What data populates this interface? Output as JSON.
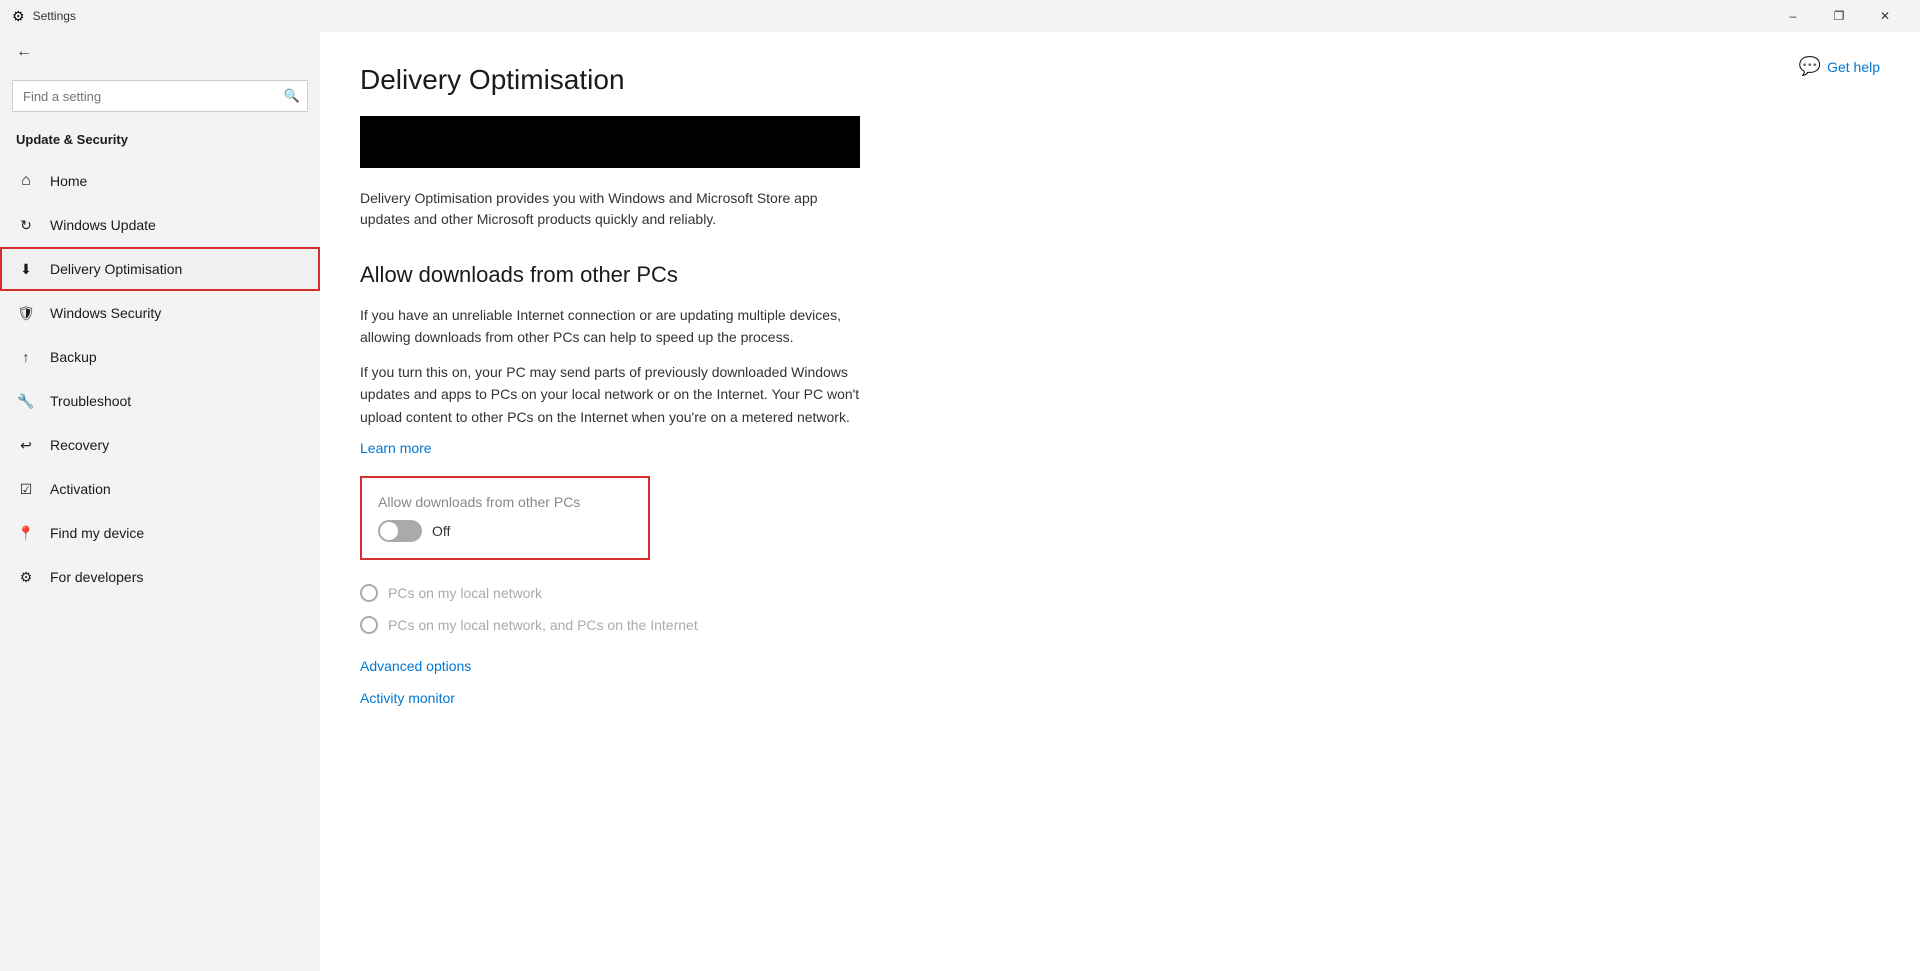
{
  "titlebar": {
    "title": "Settings",
    "minimize_label": "–",
    "maximize_label": "❐",
    "close_label": "✕"
  },
  "sidebar": {
    "back_label": "←",
    "search_placeholder": "Find a setting",
    "section_title": "Update & Security",
    "items": [
      {
        "id": "home",
        "label": "Home",
        "icon": "⌂"
      },
      {
        "id": "windows-update",
        "label": "Windows Update",
        "icon": "↻"
      },
      {
        "id": "delivery-optimisation",
        "label": "Delivery Optimisation",
        "icon": "⬇"
      },
      {
        "id": "windows-security",
        "label": "Windows Security",
        "icon": "🛡"
      },
      {
        "id": "backup",
        "label": "Backup",
        "icon": "↑"
      },
      {
        "id": "troubleshoot",
        "label": "Troubleshoot",
        "icon": "🔧"
      },
      {
        "id": "recovery",
        "label": "Recovery",
        "icon": "↩"
      },
      {
        "id": "activation",
        "label": "Activation",
        "icon": "☑"
      },
      {
        "id": "find-my-device",
        "label": "Find my device",
        "icon": "📍"
      },
      {
        "id": "for-developers",
        "label": "For developers",
        "icon": "⚙"
      }
    ]
  },
  "content": {
    "page_title": "Delivery Optimisation",
    "description": "Delivery Optimisation provides you with Windows and Microsoft Store app updates and other Microsoft products quickly and reliably.",
    "section_heading": "Allow downloads from other PCs",
    "allow_text_1": "If you have an unreliable Internet connection or are updating multiple devices, allowing downloads from other PCs can help to speed up the process.",
    "allow_text_2": "If you turn this on, your PC may send parts of previously downloaded Windows updates and apps to PCs on your local network or on the Internet. Your PC won't upload content to other PCs on the Internet when you're on a metered network.",
    "learn_more_label": "Learn more",
    "toggle_label": "Allow downloads from other PCs",
    "toggle_status": "Off",
    "toggle_state": "off",
    "radio_option_1": "PCs on my local network",
    "radio_option_2": "PCs on my local network, and PCs on the Internet",
    "advanced_options_label": "Advanced options",
    "activity_monitor_label": "Activity monitor",
    "get_help_label": "Get help"
  }
}
